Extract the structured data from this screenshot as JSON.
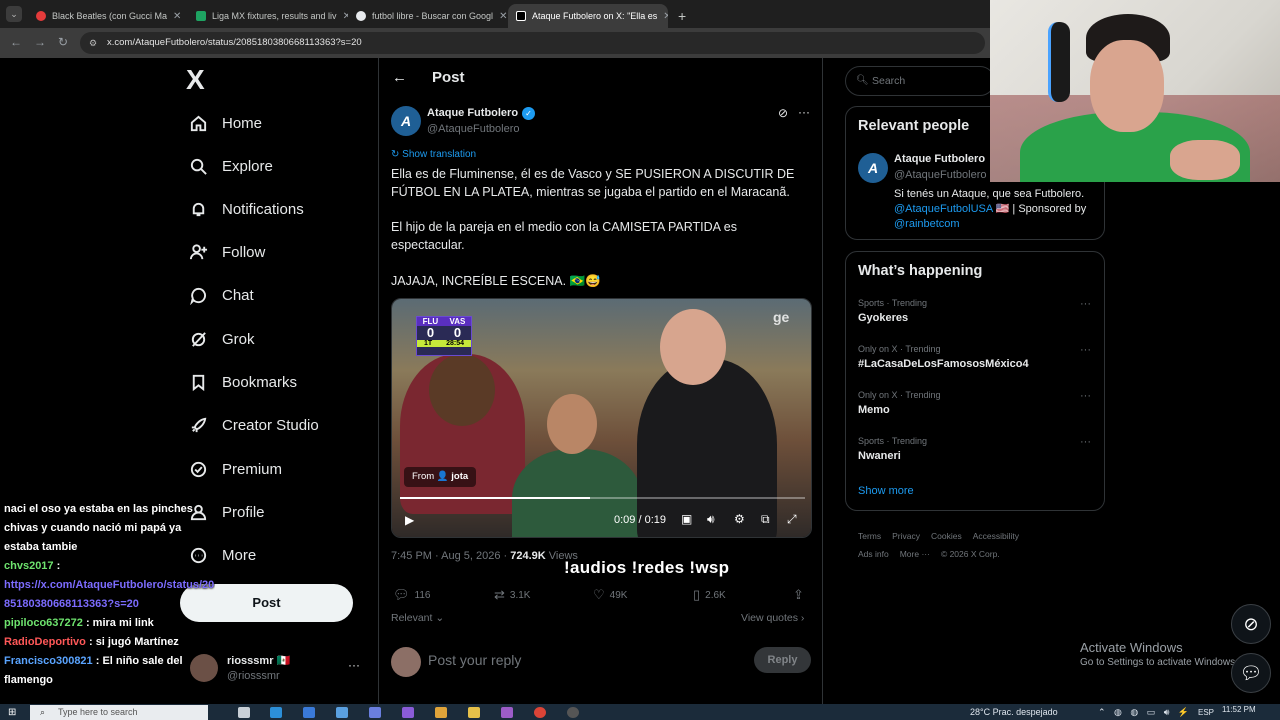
{
  "browser": {
    "tabs": [
      {
        "title": "Black Beatles (con Gucci Ma",
        "icon": "youtube-icon",
        "color": "#e43b3b"
      },
      {
        "title": "Liga MX fixtures, results and liv",
        "icon": "sheets-icon",
        "color": "#1ea362"
      },
      {
        "title": "futbol libre - Buscar con Googl",
        "icon": "google-icon",
        "color": "#e8eaed"
      },
      {
        "title": "Ataque Futbolero on X: \"Ella es",
        "icon": "x-icon",
        "color": "#ffffff"
      }
    ],
    "new_tab": "+",
    "url": "x.com/AtaqueFutbolero/status/2085180380668113363?s=20"
  },
  "x": {
    "logo": "X",
    "nav": [
      {
        "label": "Home",
        "icon": "home-icon"
      },
      {
        "label": "Explore",
        "icon": "search-icon"
      },
      {
        "label": "Notifications",
        "icon": "bell-icon"
      },
      {
        "label": "Follow",
        "icon": "follow-icon"
      },
      {
        "label": "Chat",
        "icon": "chat-icon"
      },
      {
        "label": "Grok",
        "icon": "grok-icon"
      },
      {
        "label": "Bookmarks",
        "icon": "bookmark-icon"
      },
      {
        "label": "Creator Studio",
        "icon": "rocket-icon"
      },
      {
        "label": "Premium",
        "icon": "premium-icon"
      },
      {
        "label": "Profile",
        "icon": "profile-icon"
      },
      {
        "label": "More",
        "icon": "more-icon"
      }
    ],
    "post_button": "Post",
    "account": {
      "name": "riosssmr 🇲🇽",
      "handle": "@riosssmr",
      "more": "···"
    }
  },
  "chat": [
    {
      "user": "",
      "text": "naci el oso ya estaba en las pinches chivas y cuando nació mi papá ya estaba tambie"
    },
    {
      "user": "chvs2017",
      "text": ":"
    },
    {
      "user": "",
      "link": "https://x.com/AtaqueFutbolero/status/2085180380668113363?s=20"
    },
    {
      "user": "pipiloco637272",
      "text": ": mira mi link"
    },
    {
      "user": "RadioDeportivo",
      "text": ": si jugó Martínez"
    },
    {
      "user": "Francisco300821",
      "text": ": El niño sale del flamengo"
    }
  ],
  "post": {
    "header_title": "Post",
    "author_name": "Ataque Futbolero",
    "author_handle": "@AtaqueFutbolero",
    "show_translation": "Show translation",
    "text1": "Ella es de Fluminense, él es de Vasco y SE PUSIERON A DISCUTIR DE FÚTBOL EN LA PLATEA, mientras se jugaba el partido en el Maracanã.",
    "text2": "El hijo de la pareja en el medio con la CAMISETA PARTIDA es espectacular.",
    "text3": "JAJAJA, INCREÍBLE ESCENA. 🇧🇷😅",
    "video": {
      "team1": "FLU",
      "team2": "VAS",
      "score1": "0",
      "score2": "0",
      "period": "1T",
      "clock": "28:54",
      "watermark": "ge",
      "from_label": "From",
      "from_user": "jota",
      "time": "0:09 / 0:19",
      "progress": 0.47
    },
    "timestamp": "7:45 PM · Aug 5, 2026 · ",
    "views_count": "724.9K",
    "views_label": " Views",
    "stats": {
      "replies": "116",
      "reposts": "3.1K",
      "likes": "49K",
      "bookmarks": "2.6K"
    },
    "sort_label": "Relevant",
    "view_quotes": "View quotes",
    "reply_placeholder": "Post your reply",
    "reply_button": "Reply"
  },
  "stream_overlay": "!audios  !redes  !wsp",
  "right": {
    "search_placeholder": "Search",
    "relevant_title": "Relevant people",
    "rp_name": "Ataque Futbolero",
    "rp_handle": "@AtaqueFutbolero",
    "rp_bio1": "Si tenés un Ataque, que sea Futbolero.",
    "rp_bio_link1": "@AtaqueFutbolUSA",
    "rp_bio_mid": " 🇺🇸 | Sponsored by ",
    "rp_bio_link2": "@rainbetcom",
    "happening_title": "What’s happening",
    "trends": [
      {
        "context": "Sports · Trending",
        "name": "Gyokeres"
      },
      {
        "context": "Only on X · Trending",
        "name": "#LaCasaDeLosFamososMéxico4"
      },
      {
        "context": "Only on X · Trending",
        "name": "Memo"
      },
      {
        "context": "Sports · Trending",
        "name": "Nwaneri"
      }
    ],
    "show_more": "Show more",
    "footer": [
      "Terms",
      "Privacy",
      "Cookies",
      "Accessibility",
      "Ads info",
      "More ···",
      "© 2026 X Corp."
    ]
  },
  "windows": {
    "activate_title": "Activate Windows",
    "activate_sub": "Go to Settings to activate Windows.",
    "search_placeholder": "Type here to search",
    "weather": "28°C  Prac. despejado",
    "lang": "ESP",
    "clock": "11:52 PM"
  }
}
